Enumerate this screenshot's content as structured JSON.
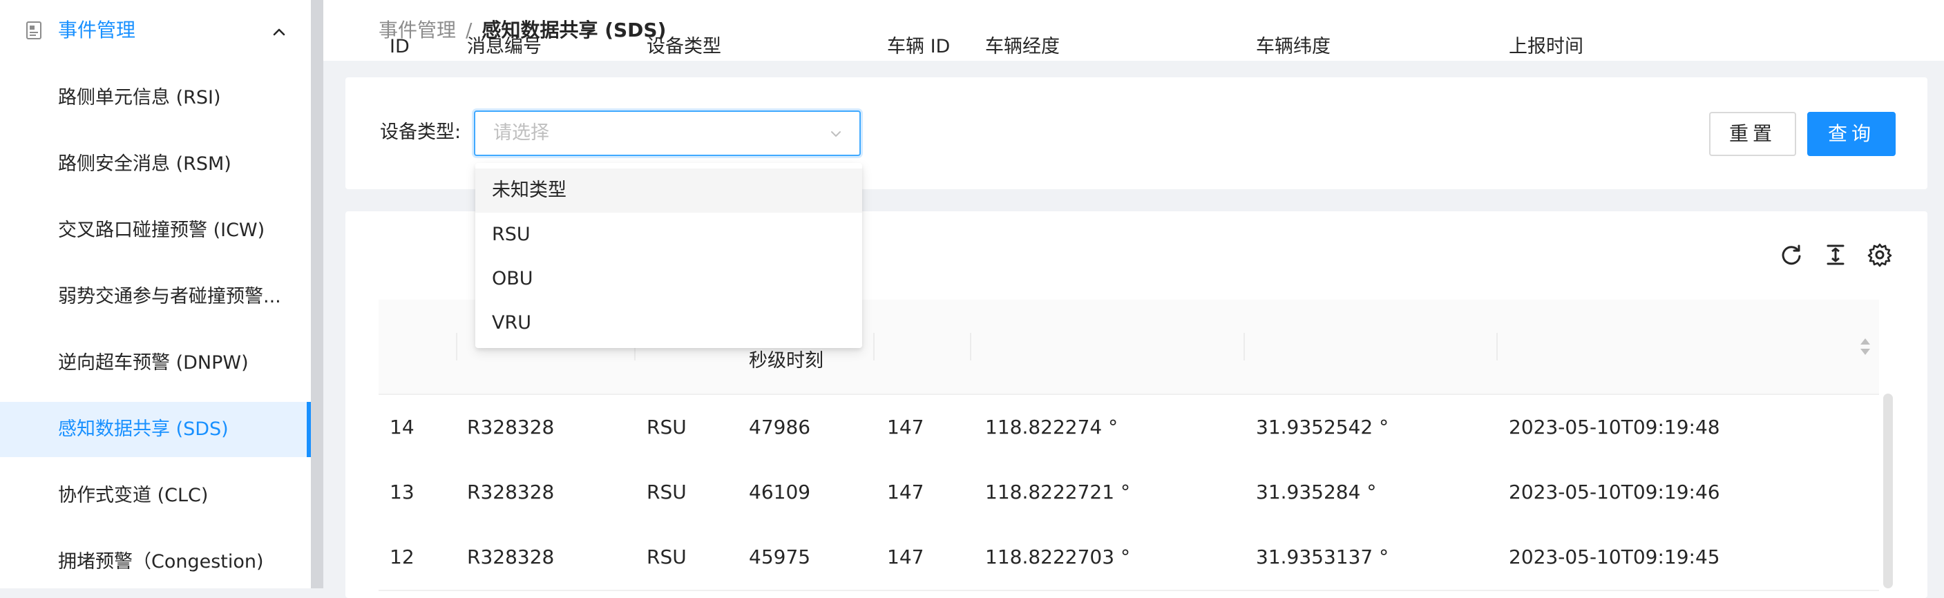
{
  "sidebar": {
    "group_title": "事件管理",
    "items": [
      {
        "label": "路侧单元信息 (RSI)"
      },
      {
        "label": "路侧安全消息 (RSM)"
      },
      {
        "label": "交叉路口碰撞预警 (ICW)"
      },
      {
        "label": "弱势交通参与者碰撞预警..."
      },
      {
        "label": "逆向超车预警 (DNPW)"
      },
      {
        "label": "感知数据共享 (SDS)",
        "active": true
      },
      {
        "label": "协作式变道 (CLC)"
      },
      {
        "label": "拥堵预警（Congestion)"
      }
    ]
  },
  "breadcrumb": {
    "parent": "事件管理",
    "separator": "/",
    "current": "感知数据共享 (SDS)"
  },
  "filter": {
    "device_type_label": "设备类型:",
    "device_type_placeholder": "请选择",
    "reset_label": "重置",
    "search_label": "查询"
  },
  "dropdown": {
    "options": [
      "未知类型",
      "RSU",
      "OBU",
      "VRU"
    ],
    "hovered_index": 0
  },
  "table": {
    "columns": {
      "id": "ID",
      "msg_no": "消息编号",
      "device_type": "设备类型",
      "sec_mark": "秒级时刻",
      "vehicle_id": "车辆 ID",
      "lon": "车辆经度",
      "lat": "车辆纬度",
      "report_time": "上报时间"
    },
    "rows": [
      {
        "id": "14",
        "msg_no": "R328328",
        "device_type": "RSU",
        "sec_mark": "47986",
        "vehicle_id": "147",
        "lon": "118.822274 °",
        "lat": "31.9352542 °",
        "report_time": "2023-05-10T09:19:48"
      },
      {
        "id": "13",
        "msg_no": "R328328",
        "device_type": "RSU",
        "sec_mark": "46109",
        "vehicle_id": "147",
        "lon": "118.8222721 °",
        "lat": "31.935284 °",
        "report_time": "2023-05-10T09:19:46"
      },
      {
        "id": "12",
        "msg_no": "R328328",
        "device_type": "RSU",
        "sec_mark": "45975",
        "vehicle_id": "147",
        "lon": "118.8222703 °",
        "lat": "31.9353137 °",
        "report_time": "2023-05-10T09:19:45"
      }
    ]
  },
  "colors": {
    "primary": "#1890ff",
    "active_bg": "#e6f2ff"
  }
}
